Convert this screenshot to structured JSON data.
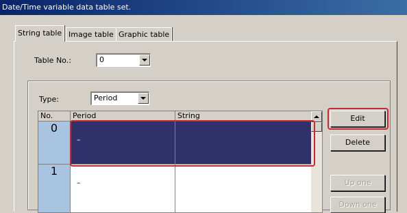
{
  "window": {
    "title": "Date/Time variable data table set."
  },
  "tabs": [
    {
      "label": "String table"
    },
    {
      "label": "Image table"
    },
    {
      "label": "Graphic table"
    }
  ],
  "table_no": {
    "label": "Table No.:",
    "value": "0"
  },
  "type": {
    "label": "Type:",
    "value": "Period"
  },
  "grid": {
    "headers": [
      "No.",
      "Period",
      "String"
    ],
    "rows": [
      {
        "no": "0",
        "period": "–",
        "string": ""
      },
      {
        "no": "1",
        "period": "–",
        "string": ""
      }
    ]
  },
  "buttons": {
    "edit": "Edit",
    "delete": "Delete",
    "up_one": "Up one",
    "down_one": "Down one"
  },
  "colors": {
    "title_bar": "#0a246a",
    "selection": "#30306a",
    "number_cell": "#a8c4e0",
    "highlight": "#c8282e"
  }
}
